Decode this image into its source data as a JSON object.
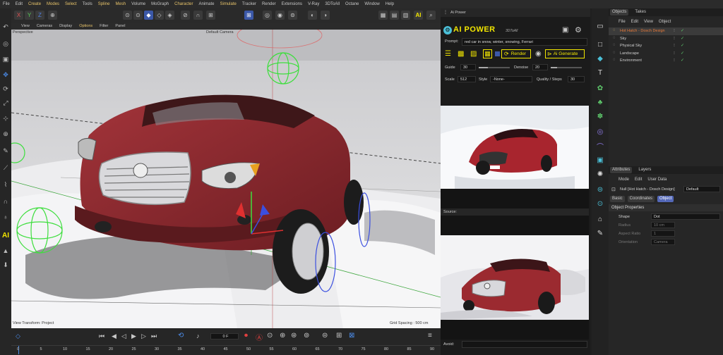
{
  "menu": {
    "items": [
      "File",
      "Edit",
      "Create",
      "Modes",
      "Select",
      "Tools",
      "Spline",
      "Mesh",
      "Volume",
      "MoGraph",
      "Character",
      "Animate",
      "Simulate",
      "Tracker",
      "Render",
      "Extensions",
      "V-Ray",
      "3DToAll",
      "Octane",
      "Window",
      "Help"
    ],
    "highlighted": [
      "Create",
      "Modes",
      "Select",
      "Spline",
      "Mesh",
      "Character",
      "Simulate"
    ]
  },
  "viewport": {
    "menu": [
      "View",
      "Cameras",
      "Display",
      "Options",
      "Filter",
      "Panel"
    ],
    "label_perspective": "Perspective",
    "label_camera": "Default Camera",
    "footer_left": "View Transform: Project",
    "footer_right": "Grid Spacing : 500 cm"
  },
  "timeline": {
    "frame": "0 F",
    "ticks": [
      "0",
      "5",
      "10",
      "15",
      "20",
      "25",
      "30",
      "35",
      "40",
      "45",
      "50",
      "55",
      "60",
      "65",
      "70",
      "75",
      "80",
      "85",
      "90"
    ]
  },
  "ai_panel": {
    "tab": "Ai Power",
    "brand": "AI POWER",
    "brand_sub": "3DToAll",
    "prompt_label": "Prompt:",
    "prompt_value": "red car in snow, winter, snowing, Ferrari",
    "render_label": "Render",
    "generate_label": "Ai Generate",
    "guide_label": "Guide",
    "guide_value": "30",
    "guide_level": 0.3,
    "denoise_label": "Denoise",
    "denoise_value": "20",
    "denoise_level": 0.2,
    "scale_label": "Scale",
    "scale_value": "512",
    "style_label": "Style",
    "style_value": "-None-",
    "quality_label": "Quality / Steps",
    "quality_value": "30",
    "source_label": "Source:",
    "avoid_label": "Avoid:"
  },
  "objects": {
    "tabs": [
      "Objects",
      "Takes"
    ],
    "menu": [
      "File",
      "Edit",
      "View",
      "Object"
    ],
    "rows": [
      {
        "name": "Hot Hatch - Dosch Design",
        "color": "#e87a3a",
        "selected": true
      },
      {
        "name": "Sky",
        "color": "#cfcfcf",
        "selected": false
      },
      {
        "name": "Physical Sky",
        "color": "#cfcfcf",
        "selected": false
      },
      {
        "name": "Landscape",
        "color": "#cfcfcf",
        "selected": false
      },
      {
        "name": "Environment",
        "color": "#cfcfcf",
        "selected": false
      }
    ]
  },
  "attributes": {
    "tabs": [
      "Attributes",
      "Layers"
    ],
    "menu": [
      "Mode",
      "Edit",
      "User Data"
    ],
    "object_title": "Null [Hot Hatch - Dosch Design]",
    "layer_value": "Default",
    "subtabs": [
      "Basic",
      "Coordinates",
      "Object"
    ],
    "section": "Object Properties",
    "shape_label": "Shape",
    "shape_value": "Dot",
    "radius_label": "Radius",
    "radius_value": "10 cm",
    "aspect_label": "Aspect Ratio",
    "aspect_value": "1",
    "orientation_label": "Orientation",
    "orientation_value": "Camera"
  },
  "colors": {
    "accent_yellow": "#f2e600",
    "active_blue": "#3b58a8",
    "car_red": "#8e2a2e",
    "highlight_orange": "#e87a3a"
  }
}
